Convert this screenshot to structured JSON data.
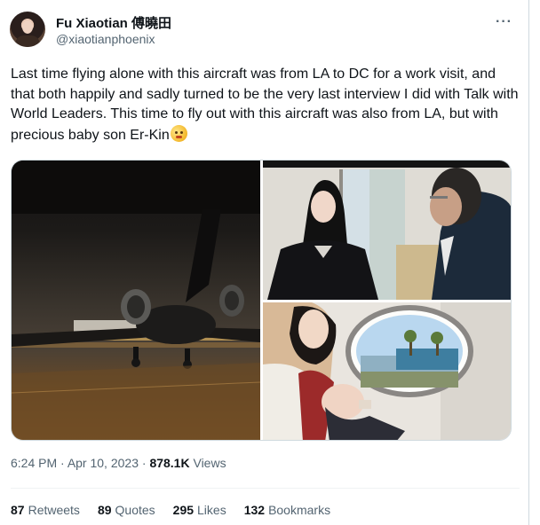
{
  "author": {
    "display_name": "Fu Xiaotian 傅曉田",
    "handle": "@xiaotianphoenix"
  },
  "more_icon": "more-horizontal-icon",
  "tweet": {
    "text": "Last time flying alone with this aircraft was from LA to DC for a work visit, and that both happily and sadly turned to be the very last interview I did with Talk with World Leaders. This time to fly out with this aircraft was also from LA, but with precious baby son Er-Kin",
    "emoji": "pleading-face-emoji"
  },
  "meta": {
    "time": "6:24 PM",
    "date": "Apr 10, 2023",
    "views_count": "878.1K",
    "views_label": "Views"
  },
  "stats": {
    "retweets": {
      "count": "87",
      "label": "Retweets"
    },
    "quotes": {
      "count": "89",
      "label": "Quotes"
    },
    "likes": {
      "count": "295",
      "label": "Likes"
    },
    "bookmarks": {
      "count": "132",
      "label": "Bookmarks"
    }
  },
  "colors": {
    "text_primary": "#0f1419",
    "text_secondary": "#536471",
    "border": "#cfd9de"
  }
}
